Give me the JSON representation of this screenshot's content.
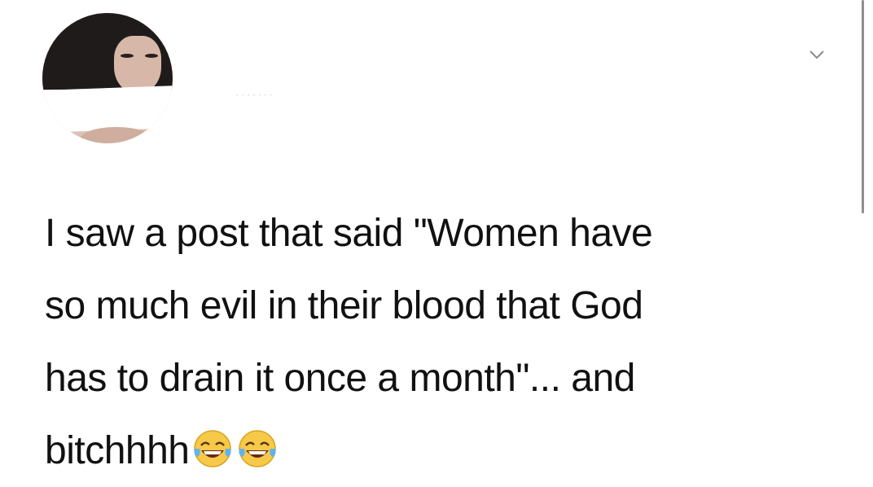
{
  "tweet": {
    "lines": [
      "I saw a post that said \"Women have",
      "so much evil in their blood that God",
      "has to drain it once a month\"... and",
      "bitchhhh"
    ],
    "emoji": [
      "tears-of-joy-emoji",
      "tears-of-joy-emoji"
    ]
  },
  "colors": {
    "text": "#111111",
    "background": "#ffffff",
    "scrollbar": "#8f8f8f"
  },
  "icons": {
    "menu": "chevron-down-icon"
  }
}
